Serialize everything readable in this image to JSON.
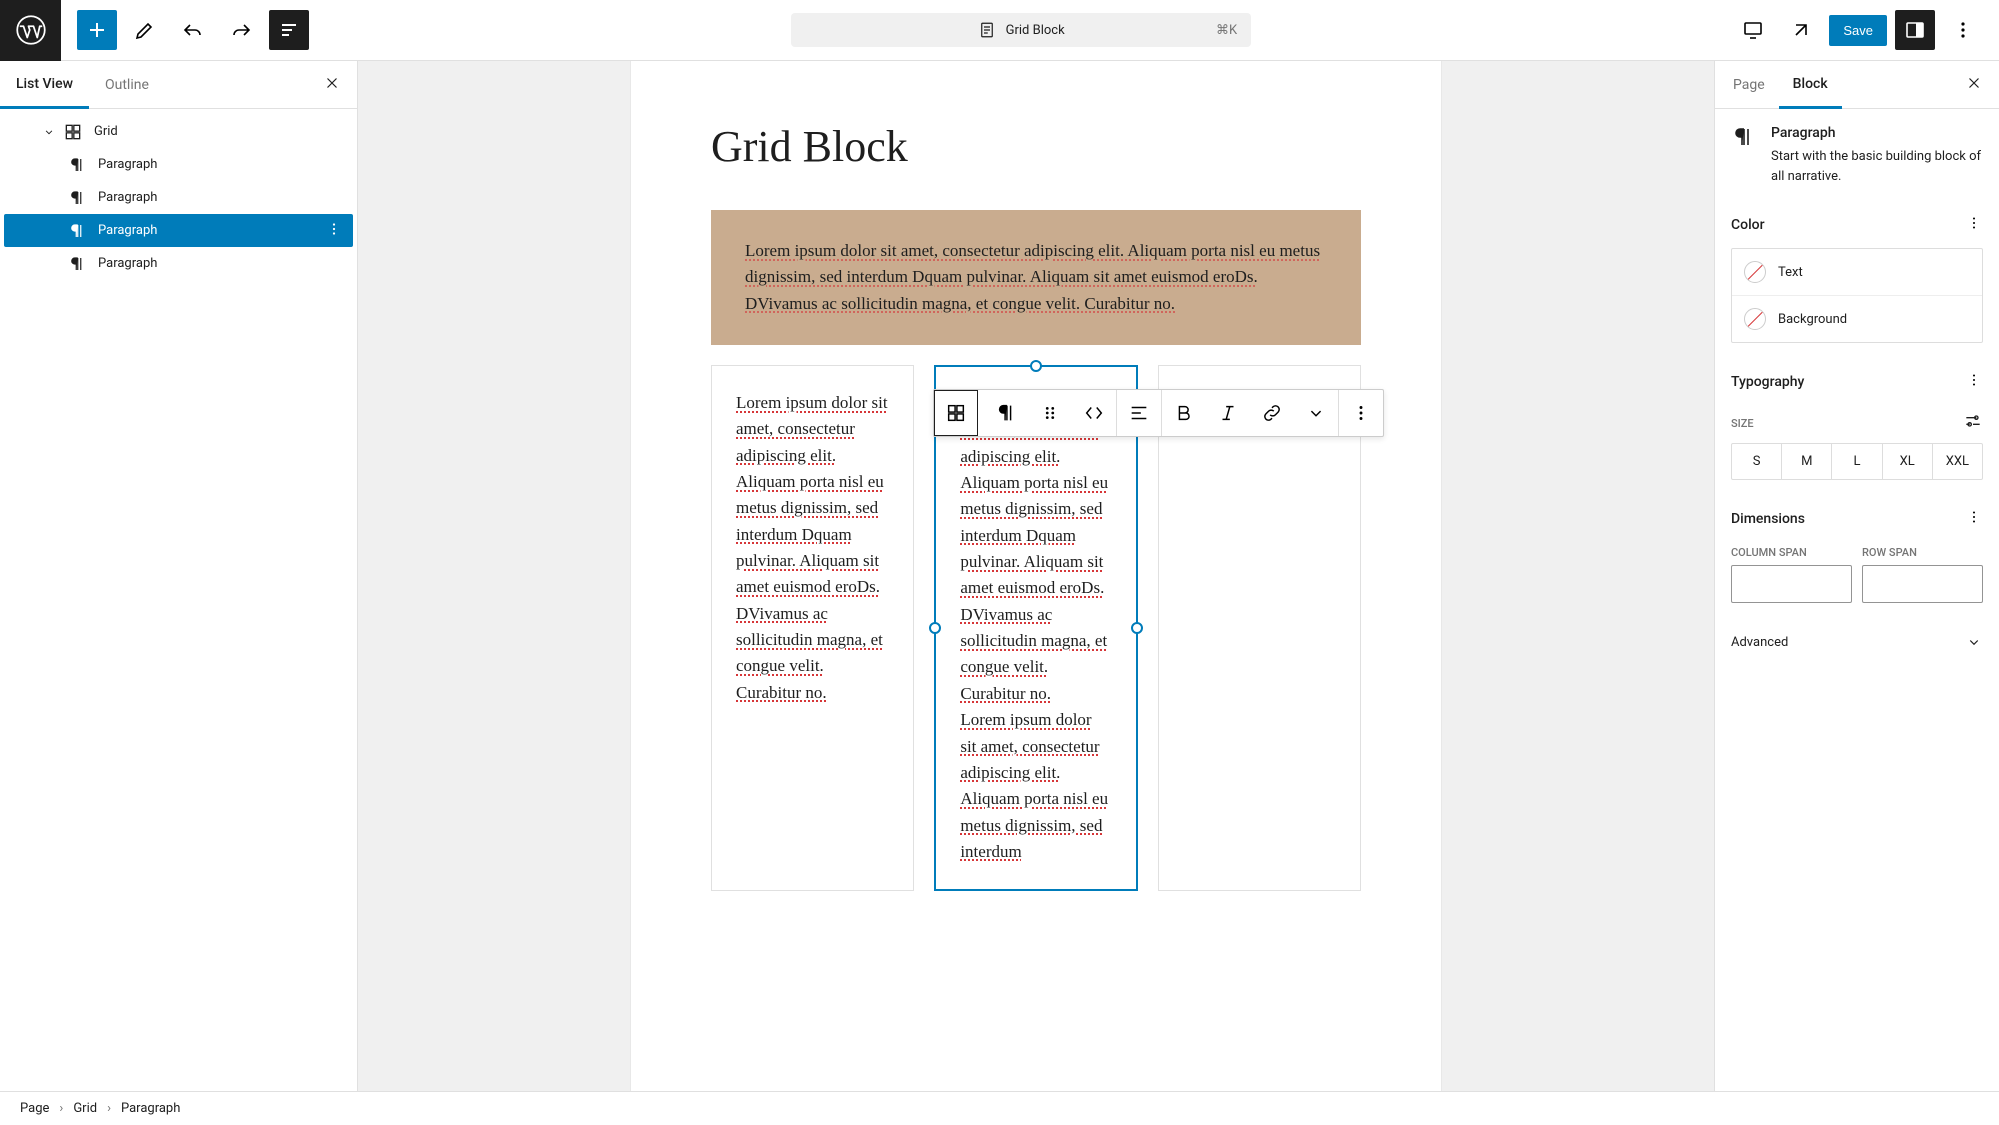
{
  "header": {
    "doc_title": "Grid Block",
    "shortcut": "⌘K",
    "save_label": "Save"
  },
  "left_panel": {
    "tabs": {
      "list_view": "List View",
      "outline": "Outline"
    },
    "tree": {
      "root": "Grid",
      "children": [
        "Paragraph",
        "Paragraph",
        "Paragraph",
        "Paragraph"
      ],
      "selected_index": 2
    }
  },
  "canvas": {
    "page_title": "Grid Block",
    "cells": [
      "Lorem ipsum dolor sit amet, consectetur adipiscing elit. Aliquam porta nisl eu metus dignissim, sed interdum Dquam pulvinar. Aliquam sit amet euismod eroDs. DVivamus ac sollicitudin magna, et congue velit. Curabitur no.",
      "Lorem ipsum dolor sit amet, consectetur adipiscing elit. Aliquam porta nisl eu metus dignissim, sed interdum Dquam pulvinar. Aliquam sit amet euismod eroDs. DVivamus ac sollicitudin magna, et congue velit. Curabitur no.",
      "Lorem ipsum dolor sit amet, consectetur adipiscing elit. Aliquam porta nisl eu metus dignissim, sed interdum Dquam pulvinar. Aliquam sit amet euismod eroDs. DVivamus ac sollicitudin magna, et congue velit. Curabitur no.\nLorem ipsum dolor sit amet, consectetur adipiscing elit. Aliquam porta nisl eu metus dignissim, sed interdum",
      ""
    ]
  },
  "right_panel": {
    "tabs": {
      "page": "Page",
      "block": "Block"
    },
    "block_name": "Paragraph",
    "block_desc": "Start with the basic building block of all narrative.",
    "sections": {
      "color": {
        "title": "Color",
        "text_label": "Text",
        "bg_label": "Background"
      },
      "typography": {
        "title": "Typography",
        "size_label": "SIZE",
        "sizes": [
          "S",
          "M",
          "L",
          "XL",
          "XXL"
        ]
      },
      "dimensions": {
        "title": "Dimensions",
        "col_span_label": "COLUMN SPAN",
        "row_span_label": "ROW SPAN"
      },
      "advanced": {
        "title": "Advanced"
      }
    }
  },
  "breadcrumb": [
    "Page",
    "Grid",
    "Paragraph"
  ]
}
